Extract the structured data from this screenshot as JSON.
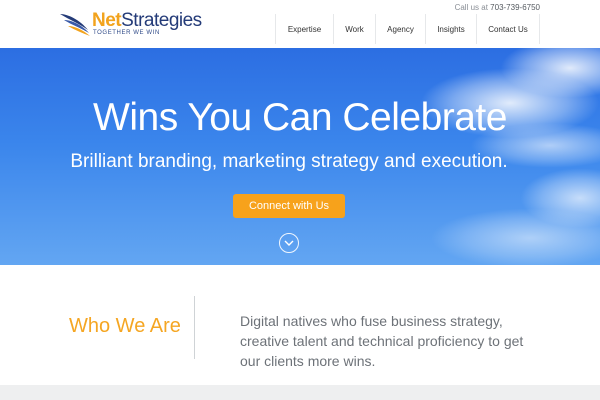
{
  "brand": {
    "name_part1": "Net",
    "name_part2": "Strategies",
    "tagline": "TOGETHER WE WIN"
  },
  "contact": {
    "label": "Call us at",
    "phone": "703-739-6750"
  },
  "nav": {
    "items": [
      {
        "label": "Expertise"
      },
      {
        "label": "Work"
      },
      {
        "label": "Agency"
      },
      {
        "label": "Insights"
      },
      {
        "label": "Contact Us"
      }
    ]
  },
  "hero": {
    "title": "Wins You Can Celebrate",
    "subtitle": "Brilliant branding, marketing strategy and execution.",
    "cta_label": "Connect with Us",
    "scroll_icon": "chevron-down-circle-icon"
  },
  "who": {
    "title": "Who We Are",
    "text": "Digital natives who fuse business strategy, creative talent and technical proficiency to get our clients more wins."
  },
  "colors": {
    "accent": "#f7a21b",
    "brand_navy": "#243b78",
    "hero_blue": "#3b86ec"
  }
}
